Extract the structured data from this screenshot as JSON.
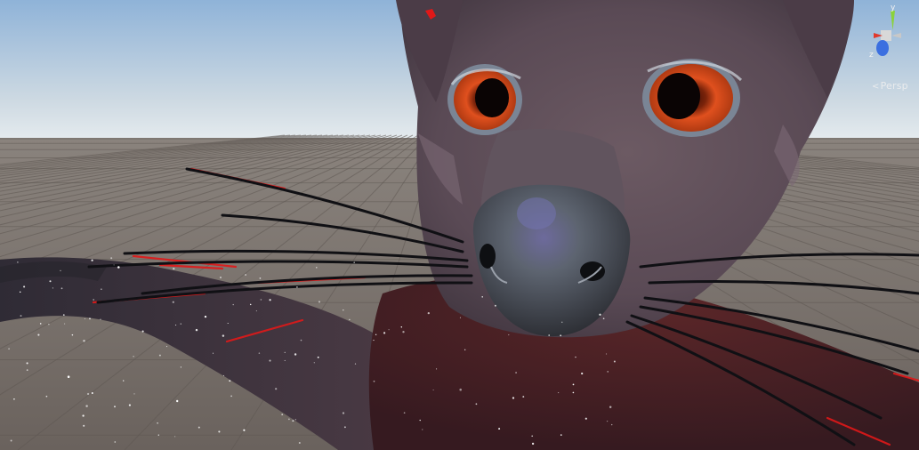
{
  "viewport": {
    "projection_label": "Persp",
    "gizmo": {
      "axis_labels": {
        "y": "y",
        "z": "z"
      },
      "colors": {
        "x": "#e0382c",
        "y": "#8bd23a",
        "z": "#3b6fe0",
        "neutral": "#d8d8d8"
      }
    },
    "sky_colors": {
      "top": "#8fb3d8",
      "horizon": "#e4ebef"
    },
    "ground_color": "#726a65",
    "subject_colors": {
      "fur": "#5a4a55",
      "iris": "#e0501e",
      "nose": "#5d6470",
      "whisker": "#101014",
      "red_strand": "#e01818"
    }
  }
}
